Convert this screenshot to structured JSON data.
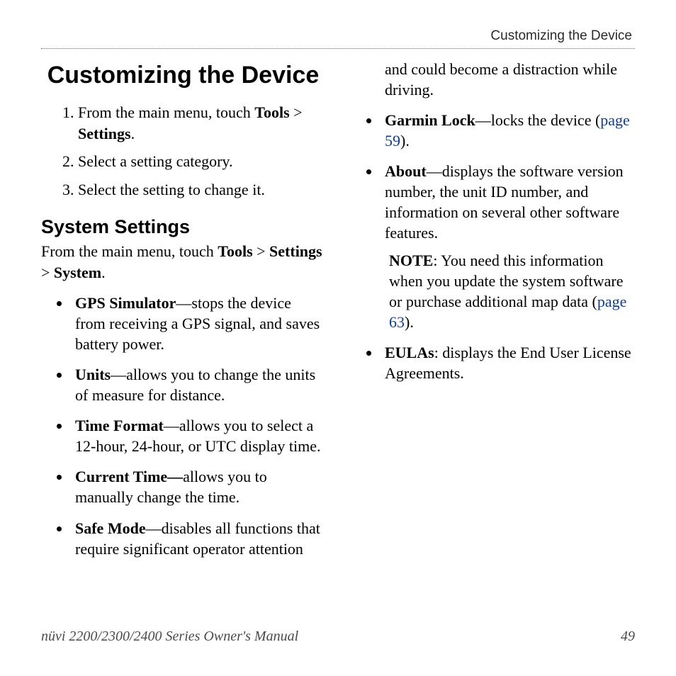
{
  "running_head": "Customizing the Device",
  "title": "Customizing the Device",
  "steps": {
    "s1_pre": "From the main menu, touch ",
    "s1_b1": "Tools",
    "s1_mid": " > ",
    "s1_b2": "Settings",
    "s1_post": ".",
    "s2": "Select a setting category.",
    "s3": "Select the setting to change it."
  },
  "section2": {
    "heading": "System Settings",
    "intro_pre": "From the main menu, touch ",
    "intro_b1": "Tools",
    "intro_mid1": " > ",
    "intro_b2": "Settings",
    "intro_mid2": " > ",
    "intro_b3": "System",
    "intro_post": "."
  },
  "bullets": {
    "gps_label": "GPS Simulator",
    "gps_desc": "—stops the device from receiving a GPS signal, and saves battery power.",
    "units_label": "Units",
    "units_desc": "—allows you to change the units of measure for distance.",
    "time_label": "Time Format",
    "time_desc": "—allows you to select a 12-hour, 24-hour, or UTC display time.",
    "curr_label": "Current Time—",
    "curr_desc": "allows you to manually change the time.",
    "safe_label": "Safe Mode",
    "safe_desc": "—disables all functions that require significant operator attention and could become a distraction while driving.",
    "lock_label": "Garmin Lock",
    "lock_desc_pre": "—locks the device (",
    "lock_link": "page 59",
    "lock_desc_post": ").",
    "about_label": "About",
    "about_desc": "—displays the software version number, the unit ID number, and information on several other software features.",
    "note_label": "NOTE",
    "note_pre": ": You need this information when you update the system software or purchase additional map data (",
    "note_link": "page 63",
    "note_post": ").",
    "eula_label": "EULAs",
    "eula_desc": ": displays the End User License Agreements."
  },
  "footer": {
    "left": "nüvi 2200/2300/2400 Series Owner's Manual",
    "right": "49"
  }
}
